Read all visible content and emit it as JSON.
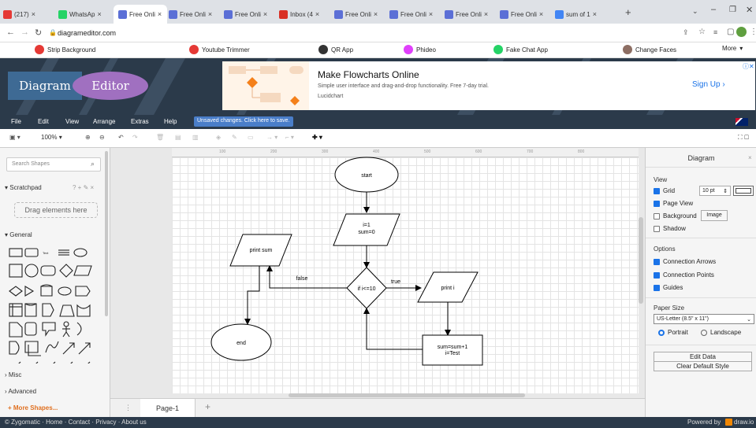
{
  "browser": {
    "tabs": [
      {
        "label": "(217)",
        "color": "#e53935"
      },
      {
        "label": "WhatsAp",
        "color": "#25d366"
      },
      {
        "label": "Free Onli",
        "color": "#5b6fd6",
        "active": true
      },
      {
        "label": "Free Onli",
        "color": "#5b6fd6"
      },
      {
        "label": "Free Onli",
        "color": "#5b6fd6"
      },
      {
        "label": "Inbox (4",
        "color": "#d93025"
      },
      {
        "label": "Free Onli",
        "color": "#5b6fd6"
      },
      {
        "label": "Free Onli",
        "color": "#5b6fd6"
      },
      {
        "label": "Free Onli",
        "color": "#5b6fd6"
      },
      {
        "label": "Free Onli",
        "color": "#5b6fd6"
      },
      {
        "label": "sum of 1",
        "color": "#4285f4"
      }
    ],
    "url": "diagrameditor.com",
    "bookmarks": [
      {
        "label": "Strip Background",
        "color": "#e53935"
      },
      {
        "label": "Youtube Trimmer",
        "color": "#e53935"
      },
      {
        "label": "QR App",
        "color": "#333333"
      },
      {
        "label": "Phideo",
        "color": "#e040fb"
      },
      {
        "label": "Fake Chat App",
        "color": "#25d366"
      },
      {
        "label": "Change Faces",
        "color": "#8d6e63"
      },
      {
        "label": "More",
        "color": "#ffffff"
      }
    ]
  },
  "banner": {
    "logo_left": "Diagram",
    "logo_right": "Editor",
    "ad_title": "Make Flowcharts Online",
    "ad_desc": "Simple user interface and drag-and-drop functionality. Free 7-day trial.",
    "ad_brand": "Lucidchart",
    "ad_cta": "Sign Up"
  },
  "menubar": {
    "items": [
      "File",
      "Edit",
      "View",
      "Arrange",
      "Extras",
      "Help"
    ],
    "unsaved": "Unsaved changes. Click here to save."
  },
  "toolbar": {
    "zoom": "100%"
  },
  "sidebar": {
    "search_placeholder": "Search Shapes",
    "scratchpad": "Scratchpad",
    "scratch_tools": "? + ✎ ×",
    "drag_hint": "Drag elements here",
    "general": "General",
    "text_shape": "Text",
    "misc": "Misc",
    "advanced": "Advanced",
    "more_shapes": "+ More Shapes..."
  },
  "diagram": {
    "start": "start",
    "init_line1": "i=1",
    "init_line2": "sum=0",
    "print_sum": "print sum",
    "condition": "if i<=10",
    "false_label": "false",
    "true_label": "true",
    "print_i": "print i",
    "end": "end",
    "update_line1": "sum=sum+1",
    "update_line2": "i=Test",
    "ruler": [
      "100",
      "200",
      "300",
      "400",
      "500",
      "600",
      "700",
      "800"
    ]
  },
  "pagetab": {
    "label": "Page-1"
  },
  "rightpanel": {
    "title": "Diagram",
    "view_header": "View",
    "grid": "Grid",
    "grid_size": "10 pt",
    "page_view": "Page View",
    "background": "Background",
    "image_btn": "Image",
    "shadow": "Shadow",
    "options_header": "Options",
    "connection_arrows": "Connection Arrows",
    "connection_points": "Connection Points",
    "guides": "Guides",
    "paper_size_header": "Paper Size",
    "paper_size": "US-Letter (8.5\" x 11\")",
    "portrait": "Portrait",
    "landscape": "Landscape",
    "edit_data": "Edit Data",
    "clear_style": "Clear Default Style"
  },
  "footer": {
    "links": "© Zygomatic · Home · Contact · Privacy · About us",
    "powered": "Powered by",
    "brand": "draw.io"
  },
  "colors": {
    "accent": "#1a73e8",
    "header_bg": "#2b3a4a",
    "logo_purple": "#a070c0"
  }
}
